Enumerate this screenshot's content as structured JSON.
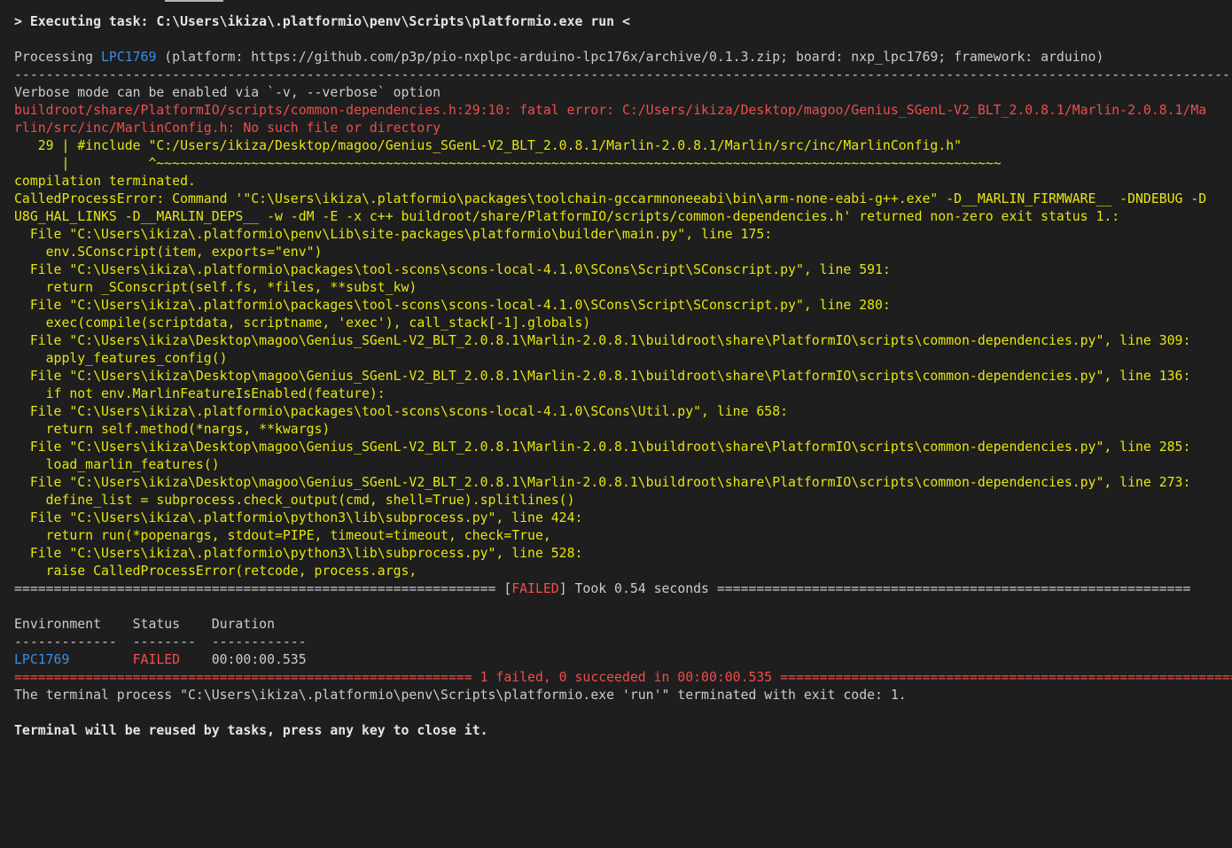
{
  "colors": {
    "background": "#1e1e1e",
    "default": "#cccccc",
    "blue": "#3b8eea",
    "red": "#f14c4c",
    "yellow": "#e5e510"
  },
  "lines": [
    [
      {
        "t": "> Executing task: C:\\Users\\ikiza\\.platformio\\penv\\Scripts\\platformio.exe run <",
        "c": "c-white",
        "b": true
      }
    ],
    [],
    [
      {
        "t": "Processing ",
        "c": "c-default"
      },
      {
        "t": "LPC1769",
        "c": "c-blue"
      },
      {
        "t": " (platform: https://github.com/p3p/pio-nxplpc-arduino-lpc176x/archive/0.1.3.zip; board: nxp_lpc1769; framework: arduino)",
        "c": "c-default"
      }
    ],
    [
      {
        "t": "---------------------------------------------------------------------------------------------------------------------------------------------------------------",
        "c": "c-default"
      }
    ],
    [
      {
        "t": "Verbose mode can be enabled via `-v, --verbose` option",
        "c": "c-default"
      }
    ],
    [
      {
        "t": "buildroot/share/PlatformIO/scripts/common-dependencies.h:29:10: fatal error: C:/Users/ikiza/Desktop/magoo/Genius_SGenL-V2_BLT_2.0.8.1/Marlin-2.0.8.1/Ma",
        "c": "c-red"
      }
    ],
    [
      {
        "t": "rlin/src/inc/MarlinConfig.h: No such file or directory",
        "c": "c-red"
      }
    ],
    [
      {
        "t": "   29 | #include \"C:/Users/ikiza/Desktop/magoo/Genius_SGenL-V2_BLT_2.0.8.1/Marlin-2.0.8.1/Marlin/src/inc/MarlinConfig.h\"",
        "c": "c-yellow"
      }
    ],
    [
      {
        "t": "      |          ^~~~~~~~~~~~~~~~~~~~~~~~~~~~~~~~~~~~~~~~~~~~~~~~~~~~~~~~~~~~~~~~~~~~~~~~~~~~~~~~~~~~~~~~~~~~~~~~~~~~~~~~~~~~",
        "c": "c-yellow"
      }
    ],
    [
      {
        "t": "compilation terminated.",
        "c": "c-yellow"
      }
    ],
    [
      {
        "t": "CalledProcessError: Command '\"C:\\Users\\ikiza\\.platformio\\packages\\toolchain-gccarmnoneeabi\\bin\\arm-none-eabi-g++.exe\" -D__MARLIN_FIRMWARE__ -DNDEBUG -D",
        "c": "c-yellow"
      }
    ],
    [
      {
        "t": "U8G_HAL_LINKS -D__MARLIN_DEPS__ -w -dM -E -x c++ buildroot/share/PlatformIO/scripts/common-dependencies.h' returned non-zero exit status 1.:",
        "c": "c-yellow"
      }
    ],
    [
      {
        "t": "  File \"C:\\Users\\ikiza\\.platformio\\penv\\Lib\\site-packages\\platformio\\builder\\main.py\", line 175:",
        "c": "c-yellow"
      }
    ],
    [
      {
        "t": "    env.SConscript(item, exports=\"env\")",
        "c": "c-yellow"
      }
    ],
    [
      {
        "t": "  File \"C:\\Users\\ikiza\\.platformio\\packages\\tool-scons\\scons-local-4.1.0\\SCons\\Script\\SConscript.py\", line 591:",
        "c": "c-yellow"
      }
    ],
    [
      {
        "t": "    return _SConscript(self.fs, *files, **subst_kw)",
        "c": "c-yellow"
      }
    ],
    [
      {
        "t": "  File \"C:\\Users\\ikiza\\.platformio\\packages\\tool-scons\\scons-local-4.1.0\\SCons\\Script\\SConscript.py\", line 280:",
        "c": "c-yellow"
      }
    ],
    [
      {
        "t": "    exec(compile(scriptdata, scriptname, 'exec'), call_stack[-1].globals)",
        "c": "c-yellow"
      }
    ],
    [
      {
        "t": "  File \"C:\\Users\\ikiza\\Desktop\\magoo\\Genius_SGenL-V2_BLT_2.0.8.1\\Marlin-2.0.8.1\\buildroot\\share\\PlatformIO\\scripts\\common-dependencies.py\", line 309:",
        "c": "c-yellow"
      }
    ],
    [
      {
        "t": "    apply_features_config()",
        "c": "c-yellow"
      }
    ],
    [
      {
        "t": "  File \"C:\\Users\\ikiza\\Desktop\\magoo\\Genius_SGenL-V2_BLT_2.0.8.1\\Marlin-2.0.8.1\\buildroot\\share\\PlatformIO\\scripts\\common-dependencies.py\", line 136:",
        "c": "c-yellow"
      }
    ],
    [
      {
        "t": "    if not env.MarlinFeatureIsEnabled(feature):",
        "c": "c-yellow"
      }
    ],
    [
      {
        "t": "  File \"C:\\Users\\ikiza\\.platformio\\packages\\tool-scons\\scons-local-4.1.0\\SCons\\Util.py\", line 658:",
        "c": "c-yellow"
      }
    ],
    [
      {
        "t": "    return self.method(*nargs, **kwargs)",
        "c": "c-yellow"
      }
    ],
    [
      {
        "t": "  File \"C:\\Users\\ikiza\\Desktop\\magoo\\Genius_SGenL-V2_BLT_2.0.8.1\\Marlin-2.0.8.1\\buildroot\\share\\PlatformIO\\scripts\\common-dependencies.py\", line 285:",
        "c": "c-yellow"
      }
    ],
    [
      {
        "t": "    load_marlin_features()",
        "c": "c-yellow"
      }
    ],
    [
      {
        "t": "  File \"C:\\Users\\ikiza\\Desktop\\magoo\\Genius_SGenL-V2_BLT_2.0.8.1\\Marlin-2.0.8.1\\buildroot\\share\\PlatformIO\\scripts\\common-dependencies.py\", line 273:",
        "c": "c-yellow"
      }
    ],
    [
      {
        "t": "    define_list = subprocess.check_output(cmd, shell=True).splitlines()",
        "c": "c-yellow"
      }
    ],
    [
      {
        "t": "  File \"C:\\Users\\ikiza\\.platformio\\python3\\lib\\subprocess.py\", line 424:",
        "c": "c-yellow"
      }
    ],
    [
      {
        "t": "    return run(*popenargs, stdout=PIPE, timeout=timeout, check=True,",
        "c": "c-yellow"
      }
    ],
    [
      {
        "t": "  File \"C:\\Users\\ikiza\\.platformio\\python3\\lib\\subprocess.py\", line 528:",
        "c": "c-yellow"
      }
    ],
    [
      {
        "t": "    raise CalledProcessError(retcode, process.args,",
        "c": "c-yellow"
      }
    ],
    [
      {
        "t": "============================================================= [",
        "c": "c-default"
      },
      {
        "t": "FAILED",
        "c": "c-red"
      },
      {
        "t": "] Took 0.54 seconds ============================================================",
        "c": "c-default"
      }
    ],
    [],
    [
      {
        "t": "Environment    Status    Duration",
        "c": "c-default"
      }
    ],
    [
      {
        "t": "-------------  --------  ------------",
        "c": "c-default"
      }
    ],
    [
      {
        "t": "LPC1769",
        "c": "c-blue"
      },
      {
        "t": "        ",
        "c": "c-default"
      },
      {
        "t": "FAILED",
        "c": "c-red"
      },
      {
        "t": "    00:00:00.535",
        "c": "c-default"
      }
    ],
    [
      {
        "t": "========================================================== 1 failed, 0 succeeded in 00:00:00.535 ==========================================================",
        "c": "c-red"
      }
    ],
    [
      {
        "t": "The terminal process \"C:\\Users\\ikiza\\.platformio\\penv\\Scripts\\platformio.exe 'run'\" terminated with exit code: 1.",
        "c": "c-default"
      }
    ],
    [],
    [
      {
        "t": "Terminal will be reused by tasks, press any key to close it.",
        "c": "c-white",
        "b": true
      }
    ]
  ]
}
